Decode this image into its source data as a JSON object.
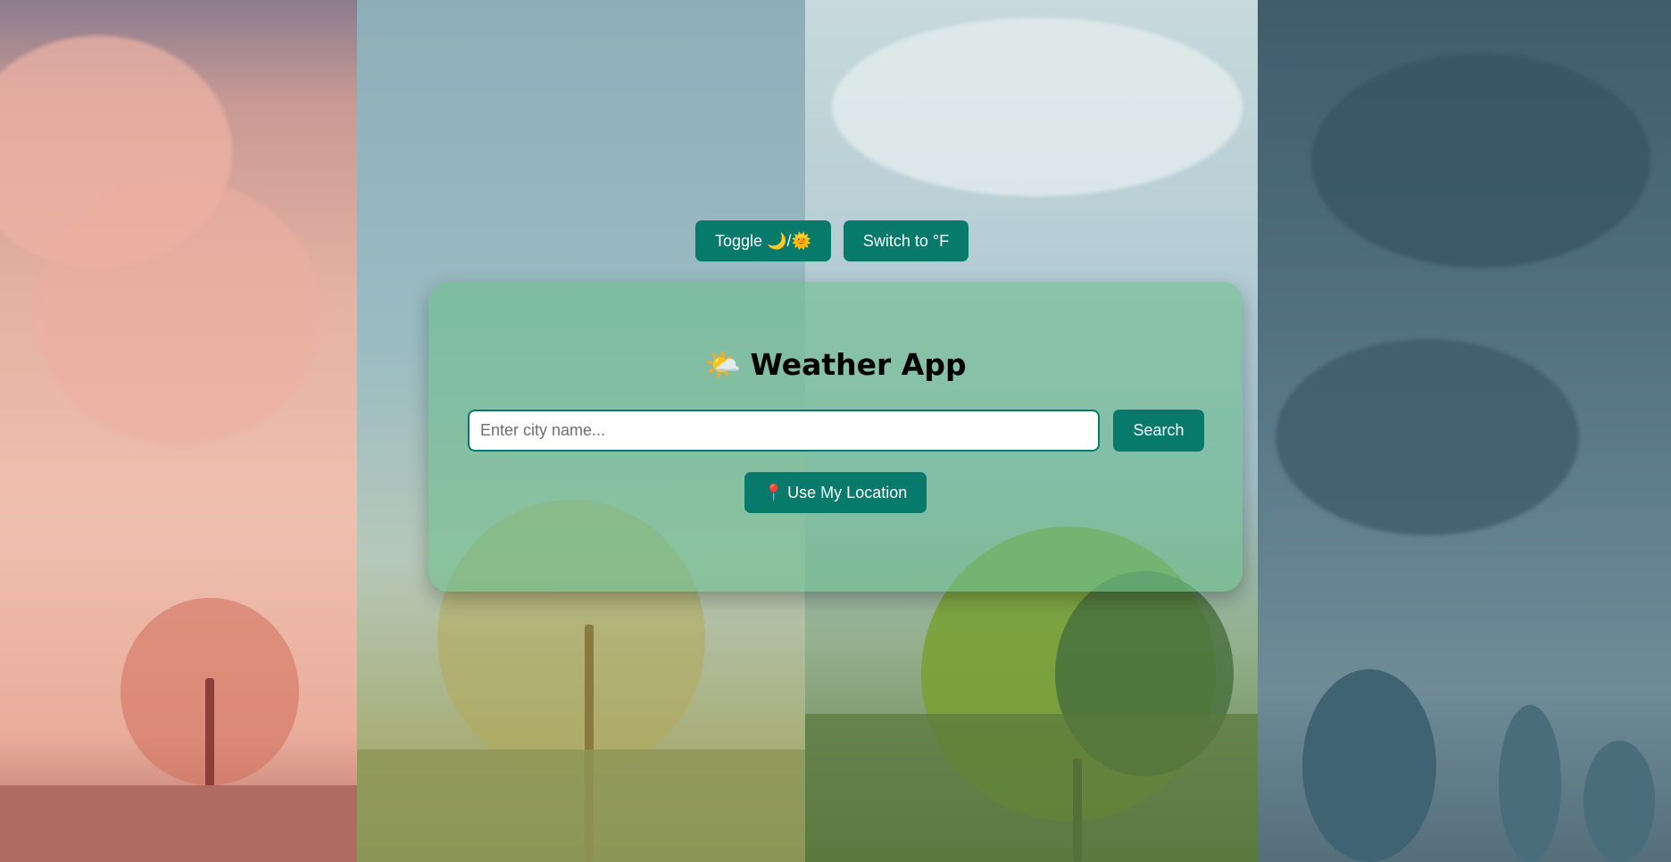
{
  "app": {
    "title": "Weather App",
    "title_icon": "🌤️"
  },
  "toolbar": {
    "theme_toggle_label": "Toggle 🌙/🌞",
    "unit_toggle_label": "Switch to °F"
  },
  "search": {
    "placeholder": "Enter city name...",
    "value": "",
    "button_label": "Search"
  },
  "location": {
    "icon": "📍",
    "button_label": "Use My Location"
  },
  "colors": {
    "accent": "#077a6c",
    "card_bg": "#70bf8f"
  }
}
